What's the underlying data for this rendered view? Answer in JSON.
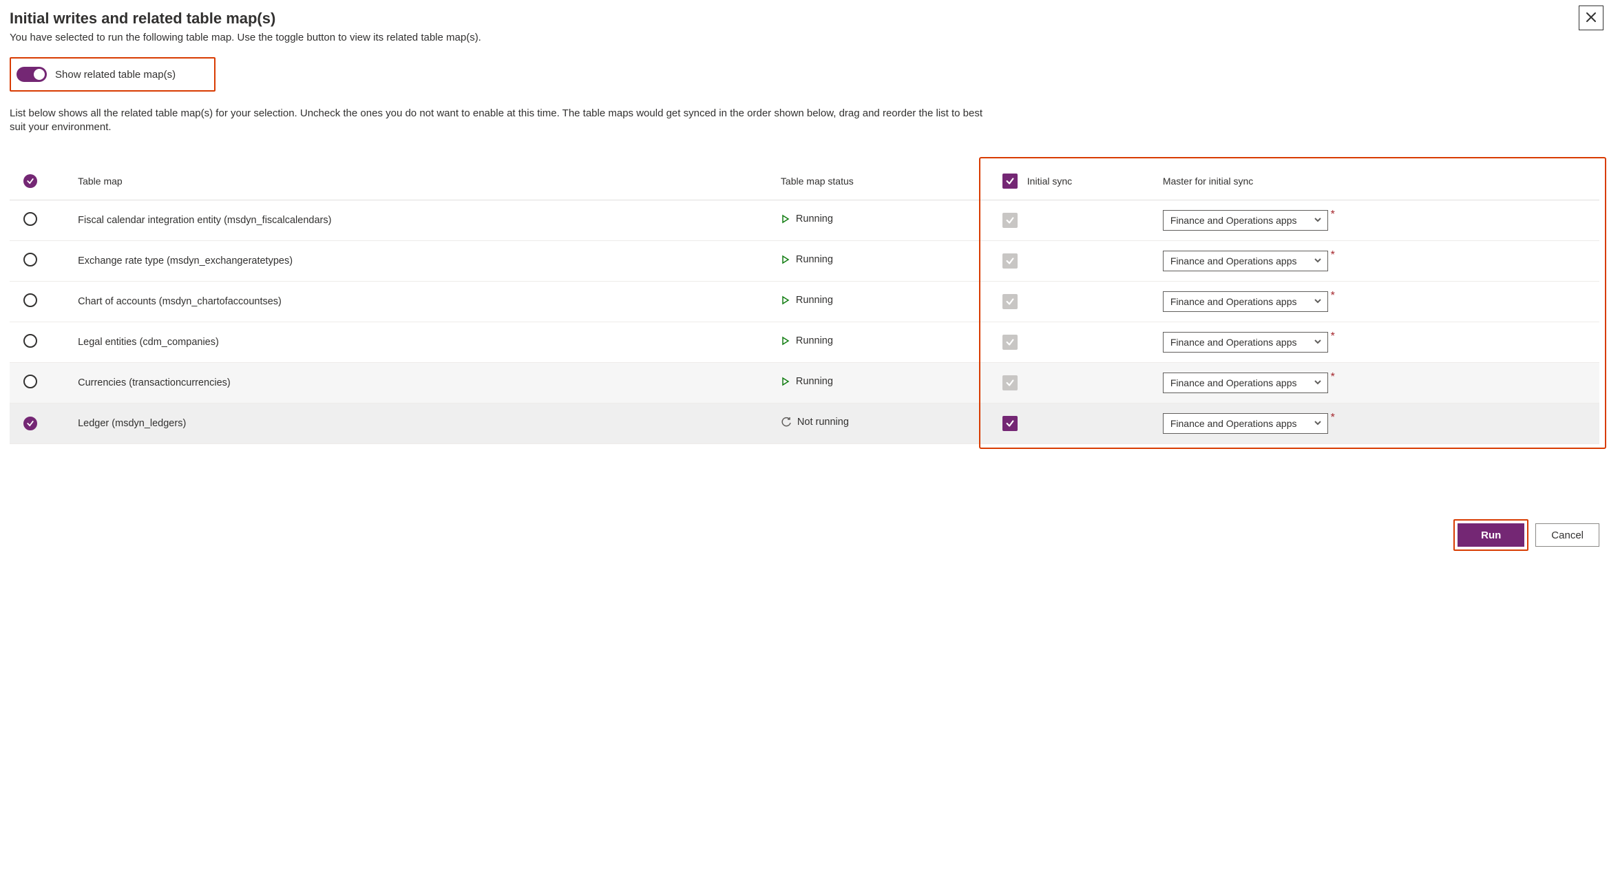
{
  "dialog": {
    "title": "Initial writes and related table map(s)",
    "intro": "You have selected to run the following table map. Use the toggle button to view its related table map(s).",
    "toggle_label": "Show related table map(s)",
    "list_description": "List below shows all the related table map(s) for your selection. Uncheck the ones you do not want to enable at this time. The table maps would get synced in the order shown below, drag and reorder the list to best suit your environment."
  },
  "columns": {
    "name": "Table map",
    "status": "Table map status",
    "initial_sync": "Initial sync",
    "master": "Master for initial sync"
  },
  "status_labels": {
    "running": "Running",
    "not_running": "Not running"
  },
  "master_default": "Finance and Operations apps",
  "rows": [
    {
      "name": "Fiscal calendar integration entity (msdyn_fiscalcalendars)",
      "status": "running",
      "selected": false,
      "initial_enabled": false,
      "shade": ""
    },
    {
      "name": "Exchange rate type (msdyn_exchangeratetypes)",
      "status": "running",
      "selected": false,
      "initial_enabled": false,
      "shade": ""
    },
    {
      "name": "Chart of accounts (msdyn_chartofaccountses)",
      "status": "running",
      "selected": false,
      "initial_enabled": false,
      "shade": ""
    },
    {
      "name": "Legal entities (cdm_companies)",
      "status": "running",
      "selected": false,
      "initial_enabled": false,
      "shade": ""
    },
    {
      "name": "Currencies (transactioncurrencies)",
      "status": "running",
      "selected": false,
      "initial_enabled": false,
      "shade": "light"
    },
    {
      "name": "Ledger (msdyn_ledgers)",
      "status": "not_running",
      "selected": true,
      "initial_enabled": true,
      "shade": "dark"
    }
  ],
  "buttons": {
    "run": "Run",
    "cancel": "Cancel"
  }
}
